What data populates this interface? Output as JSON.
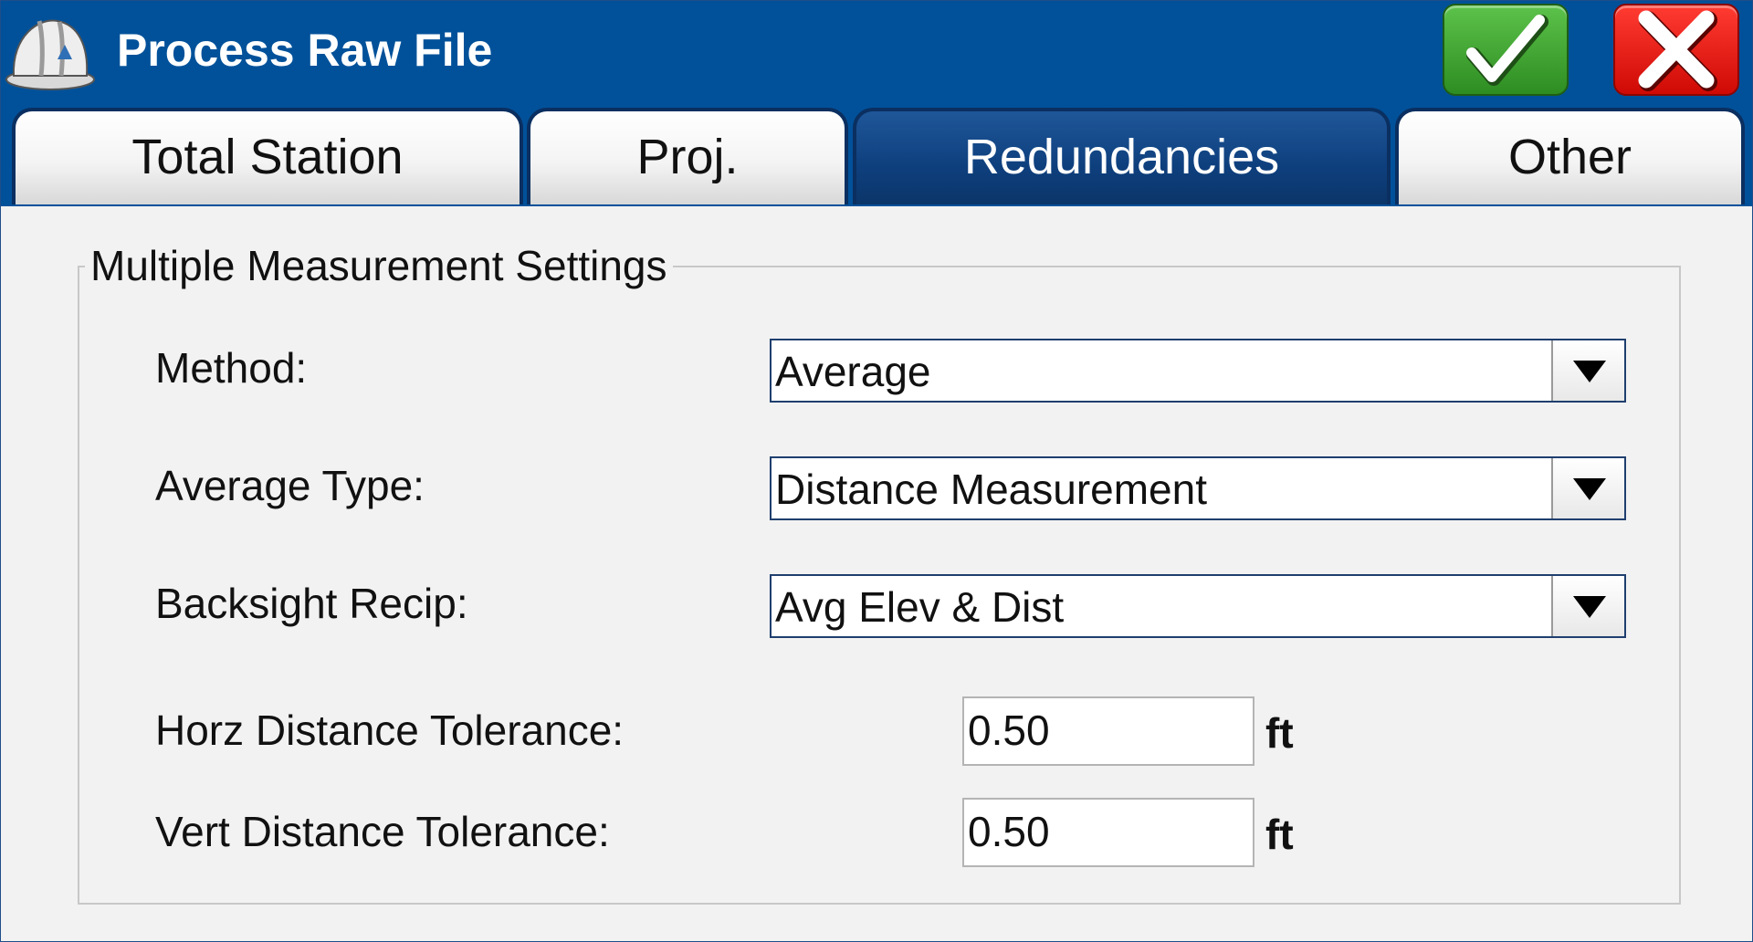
{
  "window": {
    "title": "Process Raw File",
    "app_icon": "hard-hat-icon",
    "ok_icon": "checkmark-icon",
    "cancel_icon": "close-x-icon",
    "colors": {
      "titlebar": "#01519a",
      "ok": "#3aa32c",
      "cancel": "#ee1810",
      "active_tab": "#0e3f7d"
    }
  },
  "tabs": [
    {
      "label": "Total Station",
      "active": false
    },
    {
      "label": "Proj.",
      "active": false
    },
    {
      "label": "Redundancies",
      "active": true
    },
    {
      "label": "Other",
      "active": false
    }
  ],
  "group": {
    "title": "Multiple Measurement Settings",
    "method": {
      "label": "Method:",
      "value": "Average"
    },
    "average_type": {
      "label": "Average Type:",
      "value": "Distance Measurement"
    },
    "backsight_recip": {
      "label": "Backsight Recip:",
      "value": "Avg Elev & Dist"
    },
    "horz_tol": {
      "label": "Horz Distance Tolerance:",
      "value": "0.50",
      "unit": "ft"
    },
    "vert_tol": {
      "label": "Vert Distance Tolerance:",
      "value": "0.50",
      "unit": "ft"
    }
  }
}
